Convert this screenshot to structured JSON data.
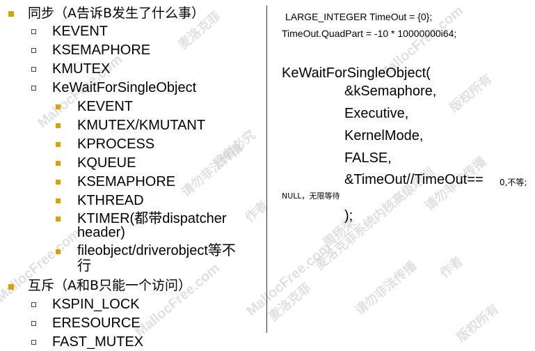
{
  "left_column": {
    "sync_heading": "同步（A告诉B发生了什么事）",
    "sync_items": [
      "KEVENT",
      "KSEMAPHORE",
      "KMUTEX",
      "KeWaitForSingleObject"
    ],
    "wait_objects": [
      "KEVENT",
      "KMUTEX/KMUTANT",
      "KPROCESS",
      "KQUEUE",
      "KSEMAPHORE",
      "KTHREAD",
      "KTIMER(都带dispatcher",
      "header)",
      "fileobject/driverobject等不",
      "行"
    ],
    "mutex_heading": "互斥（A和B只能一个访问）",
    "mutex_items": [
      "KSPIN_LOCK",
      "ERESOURCE",
      "FAST_MUTEX"
    ]
  },
  "right_column": {
    "code_line_1": "LARGE_INTEGER TimeOut =  {0};",
    "code_line_2": "TimeOut.QuadPart = -10 * 10000000i64;",
    "call_lines": [
      "KeWaitForSingleObject(",
      "&kSemaphore,",
      "Executive,",
      "KernelMode,",
      "FALSE,",
      "&TimeOut//TimeOut=="
    ],
    "inline_note": "0,不等;",
    "null_note": "NULL，无限等待",
    "closing": ");"
  },
  "watermark": {
    "site": "MallocFree.com",
    "phrases": [
      "麦洛克菲",
      "周扬荣",
      "版权所有",
      "请勿非法传播",
      "作者",
      "违者必究",
      "麦洛克菲系统内核高级培训"
    ]
  },
  "colors": {
    "primary_bullet": "#d8a200",
    "sub_bullet_border": "#1a4c8c",
    "watermark": "#c8c8c8",
    "divider": "#333333"
  }
}
